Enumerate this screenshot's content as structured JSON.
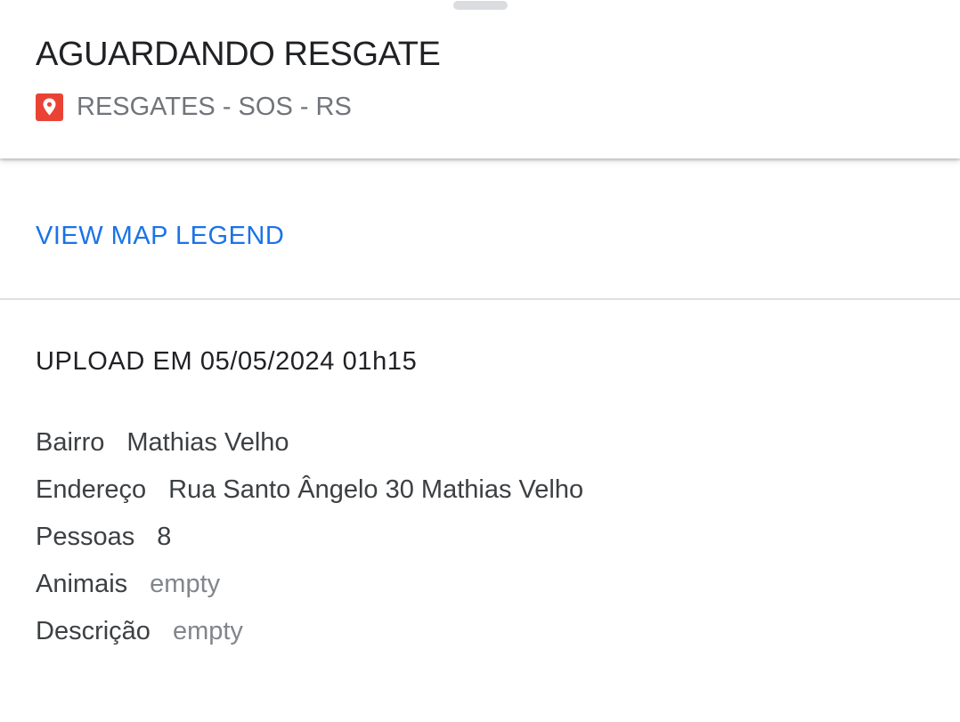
{
  "header": {
    "title": "AGUARDANDO RESGATE",
    "layer_name": "RESGATES - SOS - RS",
    "pin_color": "#ea4335",
    "pin_icon": "map-pin-icon"
  },
  "legend": {
    "link_label": "VIEW MAP LEGEND",
    "link_color": "#1a73e8"
  },
  "details": {
    "upload_heading": "UPLOAD EM 05/05/2024 01h15",
    "fields": [
      {
        "label": "Bairro",
        "value": "Mathias Velho",
        "empty": false
      },
      {
        "label": "Endereço",
        "value": "Rua Santo Ângelo 30 Mathias Velho",
        "empty": false
      },
      {
        "label": "Pessoas",
        "value": "8",
        "empty": false
      },
      {
        "label": "Animais",
        "value": "empty",
        "empty": true
      },
      {
        "label": "Descrição",
        "value": "empty",
        "empty": true
      }
    ]
  }
}
